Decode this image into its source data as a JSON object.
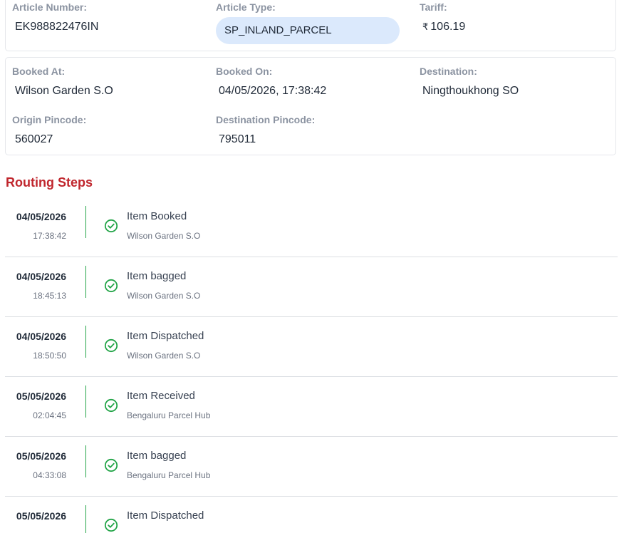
{
  "article": {
    "number_label": "Article Number:",
    "number_value": "EK988822476IN",
    "type_label": "Article Type:",
    "type_value": "SP_INLAND_PARCEL",
    "tariff_label": "Tariff:",
    "tariff_currency": "₹",
    "tariff_value": "106.19"
  },
  "booking": {
    "booked_at_label": "Booked At:",
    "booked_at_value": "Wilson Garden S.O",
    "booked_on_label": "Booked On:",
    "booked_on_value": "04/05/2026, 17:38:42",
    "destination_label": "Destination:",
    "destination_value": "Ningthoukhong SO",
    "origin_pincode_label": "Origin Pincode:",
    "origin_pincode_value": "560027",
    "destination_pincode_label": "Destination Pincode:",
    "destination_pincode_value": "795011"
  },
  "routing": {
    "title": "Routing Steps",
    "status_icon": "check-circle-icon",
    "accent_color": "#22a447",
    "steps": [
      {
        "date": "04/05/2026",
        "time": "17:38:42",
        "event": "Item Booked",
        "office": "Wilson Garden S.O"
      },
      {
        "date": "04/05/2026",
        "time": "18:45:13",
        "event": "Item bagged",
        "office": "Wilson Garden S.O"
      },
      {
        "date": "04/05/2026",
        "time": "18:50:50",
        "event": "Item Dispatched",
        "office": "Wilson Garden S.O"
      },
      {
        "date": "05/05/2026",
        "time": "02:04:45",
        "event": "Item Received",
        "office": "Bengaluru Parcel Hub"
      },
      {
        "date": "05/05/2026",
        "time": "04:33:08",
        "event": "Item bagged",
        "office": "Bengaluru Parcel Hub"
      },
      {
        "date": "05/05/2026",
        "time": "",
        "event": "Item Dispatched",
        "office": ""
      }
    ]
  }
}
